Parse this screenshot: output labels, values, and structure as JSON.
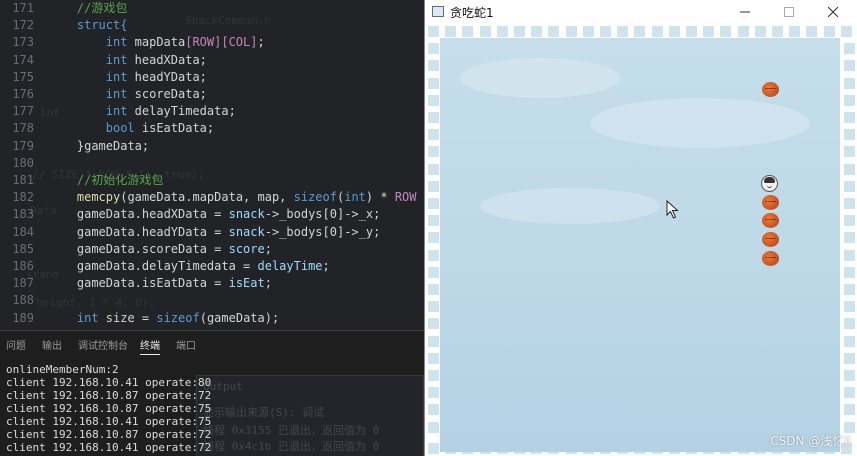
{
  "editor": {
    "lines": [
      {
        "n": "171",
        "tokens": [
          {
            "t": "//游戏包",
            "c": "cm"
          }
        ],
        "indent": 4
      },
      {
        "n": "172",
        "tokens": [
          {
            "t": "struct{",
            "c": "kw"
          }
        ],
        "indent": 4
      },
      {
        "n": "173",
        "tokens": [
          {
            "t": "int ",
            "c": "kw"
          },
          {
            "t": "mapData",
            "c": ""
          },
          {
            "t": "[ROW][COL]",
            "c": "mc"
          },
          {
            "t": ";",
            "c": ""
          }
        ],
        "indent": 8
      },
      {
        "n": "174",
        "tokens": [
          {
            "t": "int ",
            "c": "kw"
          },
          {
            "t": "headXData;",
            "c": ""
          }
        ],
        "indent": 8
      },
      {
        "n": "175",
        "tokens": [
          {
            "t": "int ",
            "c": "kw"
          },
          {
            "t": "headYData;",
            "c": ""
          }
        ],
        "indent": 8
      },
      {
        "n": "176",
        "tokens": [
          {
            "t": "int ",
            "c": "kw"
          },
          {
            "t": "scoreData;",
            "c": ""
          }
        ],
        "indent": 8
      },
      {
        "n": "177",
        "tokens": [
          {
            "t": "int ",
            "c": "kw"
          },
          {
            "t": "delayTimedata;",
            "c": ""
          }
        ],
        "indent": 8
      },
      {
        "n": "178",
        "tokens": [
          {
            "t": "bool ",
            "c": "kw"
          },
          {
            "t": "isEatData;",
            "c": ""
          }
        ],
        "indent": 8
      },
      {
        "n": "179",
        "tokens": [
          {
            "t": "}gameData;",
            "c": ""
          }
        ],
        "indent": 4
      },
      {
        "n": "180",
        "tokens": [],
        "indent": 0
      },
      {
        "n": "181",
        "tokens": [
          {
            "t": "//初始化游戏包",
            "c": "cm"
          }
        ],
        "indent": 4
      },
      {
        "n": "182",
        "tokens": [
          {
            "t": "memcpy",
            "c": "fn"
          },
          {
            "t": "(gameData.mapData, map, ",
            "c": ""
          },
          {
            "t": "sizeof",
            "c": "kw"
          },
          {
            "t": "(",
            "c": ""
          },
          {
            "t": "int",
            "c": "kw"
          },
          {
            "t": ") * ",
            "c": ""
          },
          {
            "t": "ROW",
            "c": "mc"
          },
          {
            "t": " * ",
            "c": ""
          },
          {
            "t": "C",
            "c": "mc"
          }
        ],
        "indent": 4
      },
      {
        "n": "183",
        "tokens": [
          {
            "t": "gameData.headXData = ",
            "c": ""
          },
          {
            "t": "snack",
            "c": "lv"
          },
          {
            "t": "->_bodys[0]->_x;",
            "c": ""
          }
        ],
        "indent": 4
      },
      {
        "n": "184",
        "tokens": [
          {
            "t": "gameData.headYData = ",
            "c": ""
          },
          {
            "t": "snack",
            "c": "lv"
          },
          {
            "t": "->_bodys[0]->_y;",
            "c": ""
          }
        ],
        "indent": 4
      },
      {
        "n": "185",
        "tokens": [
          {
            "t": "gameData.scoreData = ",
            "c": ""
          },
          {
            "t": "score",
            "c": "lv"
          },
          {
            "t": ";",
            "c": ""
          }
        ],
        "indent": 4
      },
      {
        "n": "186",
        "tokens": [
          {
            "t": "gameData.delayTimedata = ",
            "c": ""
          },
          {
            "t": "delayTime",
            "c": "lv"
          },
          {
            "t": ";",
            "c": ""
          }
        ],
        "indent": 4
      },
      {
        "n": "187",
        "tokens": [
          {
            "t": "gameData.isEatData = ",
            "c": ""
          },
          {
            "t": "isEat",
            "c": "lv"
          },
          {
            "t": ";",
            "c": ""
          }
        ],
        "indent": 4
      },
      {
        "n": "188",
        "tokens": [],
        "indent": 0
      },
      {
        "n": "189",
        "tokens": [
          {
            "t": "int ",
            "c": "kw"
          },
          {
            "t": "size = ",
            "c": ""
          },
          {
            "t": "sizeof",
            "c": "kw"
          },
          {
            "t": "(gameData);",
            "c": ""
          }
        ],
        "indent": 4
      }
    ]
  },
  "panel": {
    "tabs": [
      "问题",
      "输出",
      "调试控制台",
      "终端",
      "端口"
    ],
    "active_tab": "终端",
    "terminal_lines": [
      "onlineMemberNum:2",
      "client 192.168.10.41 operate:80",
      "client 192.168.10.87 operate:72",
      "client 192.168.10.87 operate:75",
      "client 192.168.10.41 operate:75",
      "client 192.168.10.87 operate:72",
      "client 192.168.10.41 operate:72"
    ]
  },
  "game_window": {
    "title": "贪吃蛇1",
    "colors": {
      "board": "#bdd8e7",
      "food": "#d0591f",
      "wall": "#cfe3ee"
    },
    "icons": [
      "minimize-icon",
      "maximize-icon",
      "close-icon"
    ]
  },
  "watermark": "CSDN @浅忆ll"
}
